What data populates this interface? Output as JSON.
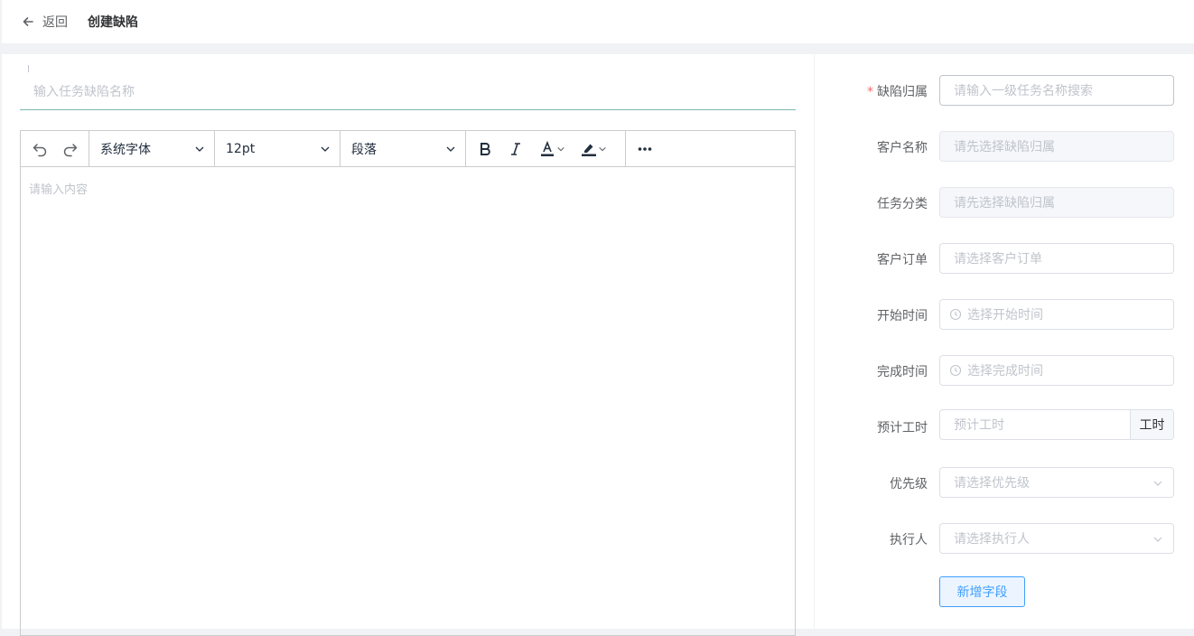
{
  "header": {
    "back_label": "返回",
    "title": "创建缺陷"
  },
  "task": {
    "name_placeholder": "输入任务缺陷名称"
  },
  "editor": {
    "font_family": "系统字体",
    "font_size": "12pt",
    "block_format": "段落",
    "content_placeholder": "请输入内容"
  },
  "form": {
    "belong": {
      "label": "缺陷归属",
      "required": "*",
      "placeholder": "请输入一级任务名称搜索"
    },
    "customer_name": {
      "label": "客户名称",
      "placeholder": "请先选择缺陷归属"
    },
    "task_category": {
      "label": "任务分类",
      "placeholder": "请先选择缺陷归属"
    },
    "customer_order": {
      "label": "客户订单",
      "placeholder": "请选择客户订单"
    },
    "start_time": {
      "label": "开始时间",
      "placeholder": "选择开始时间"
    },
    "finish_time": {
      "label": "完成时间",
      "placeholder": "选择完成时间"
    },
    "estimated_hours": {
      "label": "预计工时",
      "placeholder": "预计工时",
      "unit": "工时"
    },
    "priority": {
      "label": "优先级",
      "placeholder": "请选择优先级"
    },
    "assignee": {
      "label": "执行人",
      "placeholder": "请选择执行人"
    },
    "add_field_label": "新增字段"
  },
  "colors": {
    "accent": "#409eff",
    "required": "#f56c6c",
    "input_underline": "#7fb7b0"
  }
}
